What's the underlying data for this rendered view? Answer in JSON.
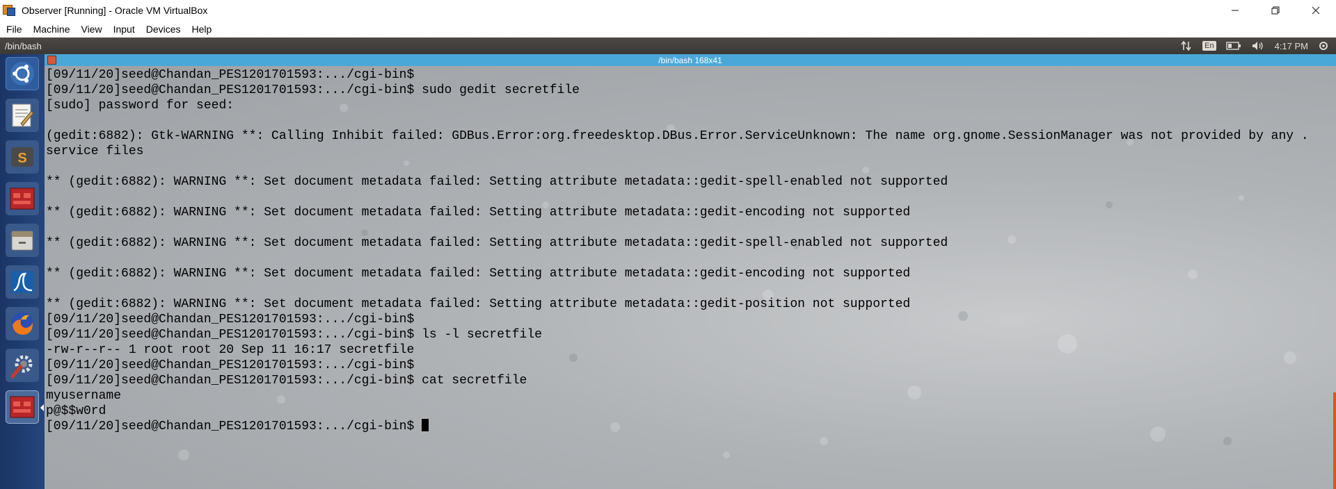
{
  "window": {
    "title": "Observer [Running] - Oracle VM VirtualBox",
    "icon": "virtualbox-icon"
  },
  "menubar": {
    "items": [
      "File",
      "Machine",
      "View",
      "Input",
      "Devices",
      "Help"
    ]
  },
  "guest_panel": {
    "title": "/bin/bash",
    "indicators": {
      "network_icon": "network-updown-icon",
      "language": "En",
      "battery_icon": "battery-icon",
      "volume_icon": "volume-icon",
      "time": "4:17 PM",
      "settings_icon": "power-gear-icon"
    }
  },
  "launcher": {
    "items": [
      {
        "name": "ubuntu-dash",
        "icon": "ubuntu-logo-icon"
      },
      {
        "name": "text-editor",
        "icon": "text-editor-icon"
      },
      {
        "name": "sublime-text",
        "icon": "sublime-text-icon"
      },
      {
        "name": "terminal",
        "icon": "terminal-icon"
      },
      {
        "name": "files",
        "icon": "file-cabinet-icon"
      },
      {
        "name": "wireshark",
        "icon": "wireshark-fin-icon"
      },
      {
        "name": "firefox",
        "icon": "firefox-icon"
      },
      {
        "name": "settings",
        "icon": "wrench-gear-icon"
      },
      {
        "name": "terminal-active",
        "icon": "terminal-icon"
      }
    ]
  },
  "terminal": {
    "title": "/bin/bash 168x41",
    "lines": [
      "[09/11/20]seed@Chandan_PES1201701593:.../cgi-bin$",
      "[09/11/20]seed@Chandan_PES1201701593:.../cgi-bin$ sudo gedit secretfile",
      "[sudo] password for seed:",
      "",
      "(gedit:6882): Gtk-WARNING **: Calling Inhibit failed: GDBus.Error:org.freedesktop.DBus.Error.ServiceUnknown: The name org.gnome.SessionManager was not provided by any .",
      "service files",
      "",
      "** (gedit:6882): WARNING **: Set document metadata failed: Setting attribute metadata::gedit-spell-enabled not supported",
      "",
      "** (gedit:6882): WARNING **: Set document metadata failed: Setting attribute metadata::gedit-encoding not supported",
      "",
      "** (gedit:6882): WARNING **: Set document metadata failed: Setting attribute metadata::gedit-spell-enabled not supported",
      "",
      "** (gedit:6882): WARNING **: Set document metadata failed: Setting attribute metadata::gedit-encoding not supported",
      "",
      "** (gedit:6882): WARNING **: Set document metadata failed: Setting attribute metadata::gedit-position not supported",
      "[09/11/20]seed@Chandan_PES1201701593:.../cgi-bin$",
      "[09/11/20]seed@Chandan_PES1201701593:.../cgi-bin$ ls -l secretfile",
      "-rw-r--r-- 1 root root 20 Sep 11 16:17 secretfile",
      "[09/11/20]seed@Chandan_PES1201701593:.../cgi-bin$",
      "[09/11/20]seed@Chandan_PES1201701593:.../cgi-bin$ cat secretfile",
      "myusername",
      "p@$$w0rd",
      "[09/11/20]seed@Chandan_PES1201701593:.../cgi-bin$ "
    ]
  }
}
